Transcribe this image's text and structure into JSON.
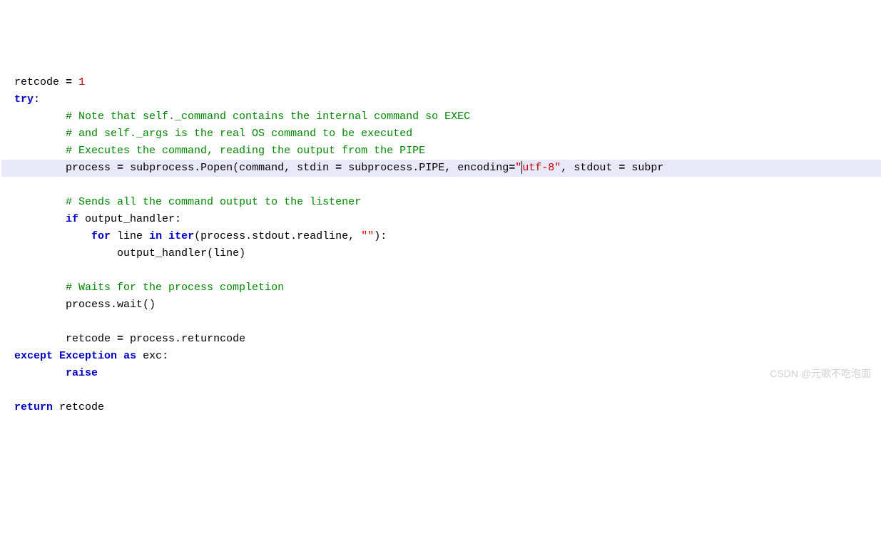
{
  "code": {
    "lines": [
      {
        "id": "l1",
        "indent": 0,
        "segments": [
          {
            "text": "retcode",
            "cls": "identifier"
          },
          {
            "text": " ",
            "cls": ""
          },
          {
            "text": "=",
            "cls": "operator"
          },
          {
            "text": " ",
            "cls": ""
          },
          {
            "text": "1",
            "cls": "number"
          }
        ]
      },
      {
        "id": "l2",
        "indent": 0,
        "segments": [
          {
            "text": "try",
            "cls": "keyword"
          },
          {
            "text": ":",
            "cls": "identifier"
          }
        ]
      },
      {
        "id": "l3",
        "indent": 2,
        "segments": [
          {
            "text": "# Note that self._command contains the internal command so EXEC",
            "cls": "comment"
          }
        ]
      },
      {
        "id": "l4",
        "indent": 2,
        "segments": [
          {
            "text": "# and self._args is the real OS command to be executed",
            "cls": "comment"
          }
        ]
      },
      {
        "id": "l5",
        "indent": 2,
        "segments": [
          {
            "text": "# Executes the command, reading the output from the PIPE",
            "cls": "comment"
          }
        ]
      },
      {
        "id": "l6",
        "indent": 2,
        "highlight": true,
        "segments": [
          {
            "text": "process",
            "cls": "identifier"
          },
          {
            "text": " ",
            "cls": ""
          },
          {
            "text": "=",
            "cls": "operator"
          },
          {
            "text": " ",
            "cls": ""
          },
          {
            "text": "subprocess.Popen",
            "cls": "identifier"
          },
          {
            "text": "(",
            "cls": "paren"
          },
          {
            "text": "command",
            "cls": "identifier"
          },
          {
            "text": ",",
            "cls": "paren"
          },
          {
            "text": " stdin ",
            "cls": "identifier"
          },
          {
            "text": "=",
            "cls": "operator"
          },
          {
            "text": " subprocess.PIPE",
            "cls": "identifier"
          },
          {
            "text": ",",
            "cls": "paren"
          },
          {
            "text": " encoding",
            "cls": "identifier"
          },
          {
            "text": "=",
            "cls": "operator"
          },
          {
            "text": "\"",
            "cls": "string"
          },
          {
            "text": "",
            "cursor": true
          },
          {
            "text": "utf-8\"",
            "cls": "string"
          },
          {
            "text": ",",
            "cls": "paren"
          },
          {
            "text": " stdout ",
            "cls": "identifier"
          },
          {
            "text": "=",
            "cls": "operator"
          },
          {
            "text": " subpr",
            "cls": "identifier"
          }
        ]
      },
      {
        "id": "l7",
        "indent": 0,
        "segments": []
      },
      {
        "id": "l8",
        "indent": 2,
        "segments": [
          {
            "text": "# Sends all the command output to the listener",
            "cls": "comment"
          }
        ]
      },
      {
        "id": "l9",
        "indent": 2,
        "segments": [
          {
            "text": "if",
            "cls": "keyword"
          },
          {
            "text": " output_handler:",
            "cls": "identifier"
          }
        ]
      },
      {
        "id": "l10",
        "indent": 3,
        "segments": [
          {
            "text": "for",
            "cls": "keyword"
          },
          {
            "text": " line ",
            "cls": "identifier"
          },
          {
            "text": "in",
            "cls": "keyword"
          },
          {
            "text": " ",
            "cls": ""
          },
          {
            "text": "iter",
            "cls": "keyword"
          },
          {
            "text": "(",
            "cls": "paren"
          },
          {
            "text": "process.stdout.readline",
            "cls": "identifier"
          },
          {
            "text": ",",
            "cls": "paren"
          },
          {
            "text": " ",
            "cls": ""
          },
          {
            "text": "\"\"",
            "cls": "string"
          },
          {
            "text": "):",
            "cls": "paren"
          }
        ]
      },
      {
        "id": "l11",
        "indent": 4,
        "segments": [
          {
            "text": "output_handler",
            "cls": "identifier"
          },
          {
            "text": "(",
            "cls": "paren"
          },
          {
            "text": "line",
            "cls": "identifier"
          },
          {
            "text": ")",
            "cls": "paren"
          }
        ]
      },
      {
        "id": "l12",
        "indent": 0,
        "segments": []
      },
      {
        "id": "l13",
        "indent": 2,
        "segments": [
          {
            "text": "# Waits for the process completion",
            "cls": "comment"
          }
        ]
      },
      {
        "id": "l14",
        "indent": 2,
        "segments": [
          {
            "text": "process.wait",
            "cls": "identifier"
          },
          {
            "text": "()",
            "cls": "paren"
          }
        ]
      },
      {
        "id": "l15",
        "indent": 0,
        "segments": []
      },
      {
        "id": "l16",
        "indent": 2,
        "segments": [
          {
            "text": "retcode ",
            "cls": "identifier"
          },
          {
            "text": "=",
            "cls": "operator"
          },
          {
            "text": " process.returncode",
            "cls": "identifier"
          }
        ]
      },
      {
        "id": "l17",
        "indent": 0,
        "segments": [
          {
            "text": "except",
            "cls": "keyword"
          },
          {
            "text": " ",
            "cls": ""
          },
          {
            "text": "Exception",
            "cls": "keyword"
          },
          {
            "text": " ",
            "cls": ""
          },
          {
            "text": "as",
            "cls": "keyword"
          },
          {
            "text": " exc:",
            "cls": "identifier"
          }
        ]
      },
      {
        "id": "l18",
        "indent": 2,
        "segments": [
          {
            "text": "raise",
            "cls": "keyword"
          }
        ]
      },
      {
        "id": "l19",
        "indent": 0,
        "segments": []
      },
      {
        "id": "l20",
        "indent": 0,
        "segments": [
          {
            "text": "return",
            "cls": "keyword"
          },
          {
            "text": " retcode",
            "cls": "identifier"
          }
        ]
      }
    ]
  },
  "watermark": "CSDN @元歌不吃泡面",
  "indent_spaces": "    "
}
